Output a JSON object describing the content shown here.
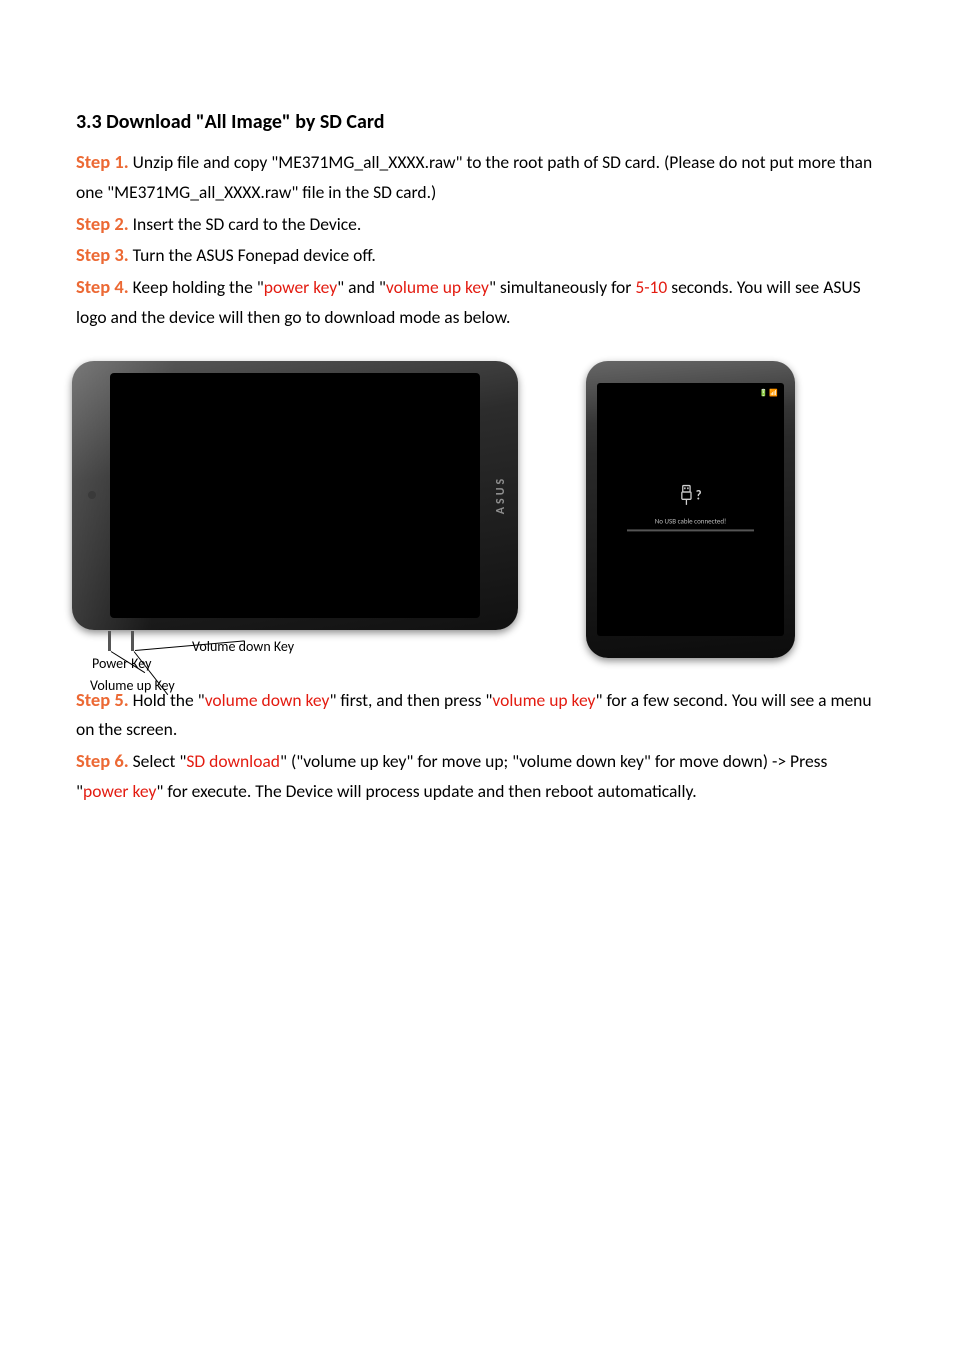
{
  "heading": "3.3 Download \"All Image\" by SD Card",
  "steps": {
    "s1": {
      "label": "Step 1.",
      "t1": " Unzip file and copy \"ME371MG_all_XXXX.raw\" to the root path of SD card. (Please do not put more than one \"ME371MG_all_XXXX.raw\" file in the SD card.)"
    },
    "s2": {
      "label": "Step 2.",
      "t1": " Insert the SD card to the Device."
    },
    "s3": {
      "label": "Step 3.",
      "t1": " Turn the ASUS Fonepad device off."
    },
    "s4": {
      "label": "Step 4.",
      "t1": " Keep holding the \"",
      "r1": "power key",
      "t2": "\" and \"",
      "r2": "volume up key",
      "t3": "\" simultaneously for ",
      "r3": "5-10",
      "t4": " seconds. You will see ASUS logo and the device will then go to download mode as below."
    },
    "s5": {
      "label": "Step 5.",
      "t1": " Hold the \"",
      "r1": "volume down key",
      "t2": "\" first, and then press \"",
      "r2": "volume up key",
      "t3": "\" for a few second. You will see a menu on the screen."
    },
    "s6": {
      "label": "Step 6.",
      "t1": " Select \"",
      "r1": "SD download",
      "t2": "\" (\"volume up key\" for move up; \"volume down key\" for move down) -> Press \"",
      "r2": "power key",
      "t3": "\" for execute. The Device will process update and then reboot automatically."
    }
  },
  "figure": {
    "power_key": "Power Key",
    "volume_up_key": "Volume up Key",
    "volume_down_key": "Volume down Key",
    "brand": "ASUS",
    "no_usb": "No USB cable connected!",
    "status_icons": "🔋 📶"
  }
}
